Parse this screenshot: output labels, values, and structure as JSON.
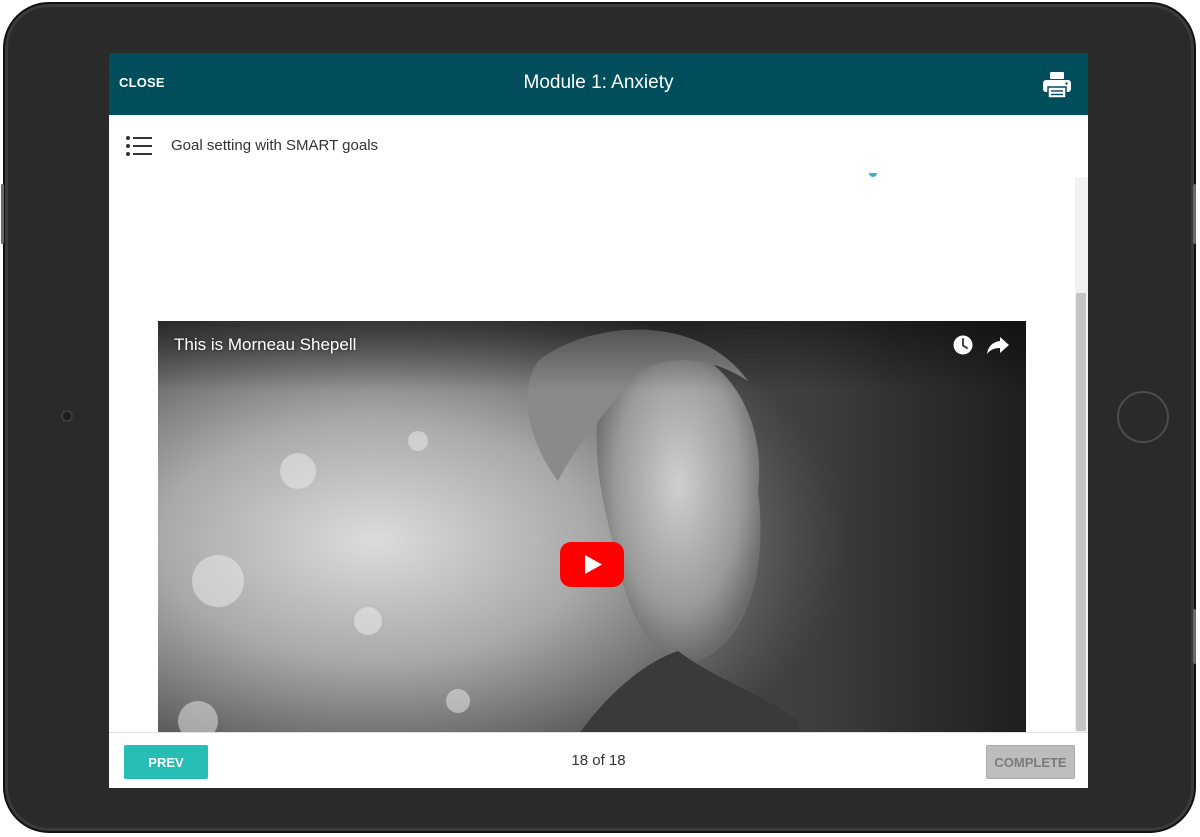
{
  "header": {
    "close_label": "CLOSE",
    "title": "Module 1: Anxiety",
    "print_icon": "printer-icon",
    "background_color": "#004d5c"
  },
  "lesson": {
    "menu_icon": "list-icon",
    "title": "Goal setting with SMART goals"
  },
  "video": {
    "title": "This is Morneau Shepell",
    "icons": [
      "clock-icon",
      "share-icon",
      "play-icon"
    ],
    "play_color": "#ff0000"
  },
  "footer": {
    "prev_label": "PREV",
    "page_indicator": "18 of 18",
    "complete_label": "COMPLETE",
    "prev_color": "#26bdb4",
    "complete_color": "#bdbdbd"
  }
}
